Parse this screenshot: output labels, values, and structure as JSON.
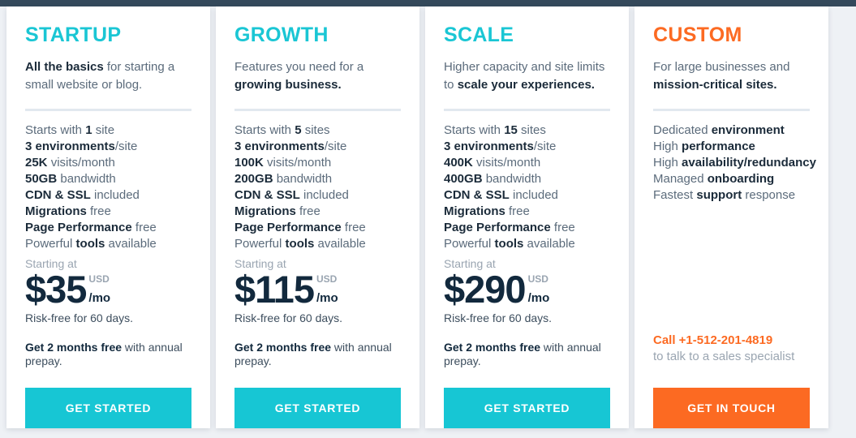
{
  "theme": {
    "accent_cyan": "#17c6d4",
    "accent_orange": "#fc6a22",
    "heading_dark": "#12293d",
    "body_gray": "#5b6b7b",
    "muted_gray": "#9aa5b1",
    "rule_color": "#e2e8ef",
    "page_background": "#eef1f5",
    "top_strip": "#34495b"
  },
  "plans": [
    {
      "name": "STARTUP",
      "tagline_bold": "All the basics",
      "tagline_rest": " for starting a small website or blog.",
      "features": [
        {
          "pre": "Starts with ",
          "bold": "1",
          "post": " site"
        },
        {
          "pre": "",
          "bold": "3 environments",
          "post": "/site"
        },
        {
          "pre": "",
          "bold": "25K",
          "post": " visits/month"
        },
        {
          "pre": "",
          "bold": "50GB",
          "post": " bandwidth"
        },
        {
          "pre": "",
          "bold": "CDN & SSL",
          "post": " included"
        },
        {
          "pre": "",
          "bold": "Migrations",
          "post": " free"
        },
        {
          "pre": "",
          "bold": "Page Performance",
          "post": " free"
        },
        {
          "pre": "Powerful ",
          "bold": "tools",
          "post": " available"
        }
      ],
      "starting_at": "Starting at",
      "amount": "$35",
      "currency": "USD",
      "period": "/mo",
      "riskfree": "Risk-free for 60 days.",
      "promo_bold": "Get 2 months free",
      "promo_rest": " with annual prepay.",
      "cta_label": "GET STARTED"
    },
    {
      "name": "GROWTH",
      "tagline_bold": "growing business.",
      "tagline_pre": "Features you need for a ",
      "features": [
        {
          "pre": "Starts with ",
          "bold": "5",
          "post": " sites"
        },
        {
          "pre": "",
          "bold": "3 environments",
          "post": "/site"
        },
        {
          "pre": "",
          "bold": "100K",
          "post": " visits/month"
        },
        {
          "pre": "",
          "bold": "200GB",
          "post": " bandwidth"
        },
        {
          "pre": "",
          "bold": "CDN & SSL",
          "post": " included"
        },
        {
          "pre": "",
          "bold": "Migrations",
          "post": " free"
        },
        {
          "pre": "",
          "bold": "Page Performance",
          "post": " free"
        },
        {
          "pre": "Powerful ",
          "bold": "tools",
          "post": " available"
        }
      ],
      "starting_at": "Starting at",
      "amount": "$115",
      "currency": "USD",
      "period": "/mo",
      "riskfree": "Risk-free for 60 days.",
      "promo_bold": "Get 2 months free",
      "promo_rest": " with annual prepay.",
      "cta_label": "GET STARTED"
    },
    {
      "name": "SCALE",
      "tagline_pre": "Higher capacity and site limits to ",
      "tagline_bold": "scale your experiences.",
      "features": [
        {
          "pre": "Starts with ",
          "bold": "15",
          "post": " sites"
        },
        {
          "pre": "",
          "bold": "3 environments",
          "post": "/site"
        },
        {
          "pre": "",
          "bold": "400K",
          "post": " visits/month"
        },
        {
          "pre": "",
          "bold": "400GB",
          "post": " bandwidth"
        },
        {
          "pre": "",
          "bold": "CDN & SSL",
          "post": " included"
        },
        {
          "pre": "",
          "bold": "Migrations",
          "post": " free"
        },
        {
          "pre": "",
          "bold": "Page Performance",
          "post": " free"
        },
        {
          "pre": "Powerful ",
          "bold": "tools",
          "post": " available"
        }
      ],
      "starting_at": "Starting at",
      "amount": "$290",
      "currency": "USD",
      "period": "/mo",
      "riskfree": "Risk-free for 60 days.",
      "promo_bold": "Get 2 months free",
      "promo_rest": " with annual prepay.",
      "cta_label": "GET STARTED"
    },
    {
      "name": "CUSTOM",
      "tagline_pre": "For large businesses and ",
      "tagline_bold": "mission-critical sites.",
      "features": [
        {
          "pre": "Dedicated ",
          "bold": "environment",
          "post": ""
        },
        {
          "pre": "High ",
          "bold": "performance",
          "post": ""
        },
        {
          "pre": "High ",
          "bold": "availability/redundancy",
          "post": ""
        },
        {
          "pre": "Managed ",
          "bold": "onboarding",
          "post": ""
        },
        {
          "pre": "Fastest ",
          "bold": "support",
          "post": " response"
        }
      ],
      "call_label": "Call +1-512-201-4819",
      "call_sub": "to talk to a sales specialist",
      "cta_label": "GET IN TOUCH"
    }
  ]
}
